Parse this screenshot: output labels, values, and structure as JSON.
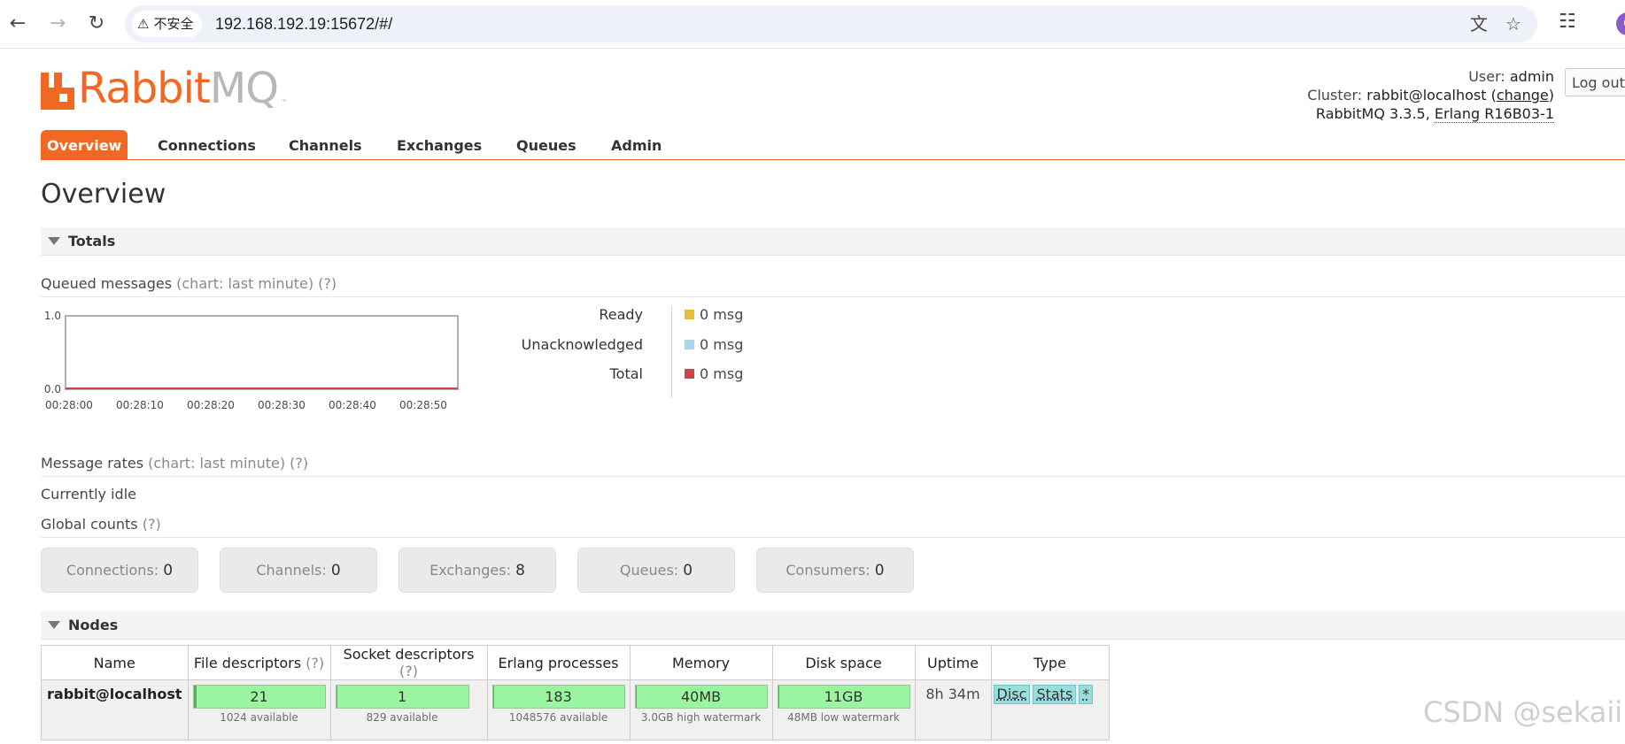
{
  "browser": {
    "security_label": "不安全",
    "url": "192.168.192.19:15672/#/"
  },
  "header": {
    "logo_rabbit": "Rabbit",
    "logo_mq": "MQ",
    "logo_tm": "™",
    "user_label": "User:",
    "user_value": "admin",
    "cluster_label": "Cluster:",
    "cluster_value": "rabbit@localhost",
    "cluster_change_open": "(",
    "cluster_change": "change",
    "cluster_change_close": ")",
    "version": "RabbitMQ 3.3.5,",
    "erlang": "Erlang R16B03-1",
    "logout": "Log out"
  },
  "tabs": [
    "Overview",
    "Connections",
    "Channels",
    "Exchanges",
    "Queues",
    "Admin"
  ],
  "page_title": "Overview",
  "totals": {
    "section_title": "Totals",
    "queued_title": "Queued messages",
    "queued_hint": "(chart: last minute)",
    "queued_help": "(?)",
    "legend": [
      {
        "name": "Ready",
        "value": "0 msg",
        "color": "#e8bc3c"
      },
      {
        "name": "Unacknowledged",
        "value": "0 msg",
        "color": "#aad4f0"
      },
      {
        "name": "Total",
        "value": "0 msg",
        "color": "#cc4444"
      }
    ],
    "rates_title": "Message rates",
    "rates_hint": "(chart: last minute)",
    "rates_help": "(?)",
    "idle": "Currently idle",
    "global_title": "Global counts",
    "global_help": "(?)",
    "counts": [
      {
        "label": "Connections:",
        "value": "0"
      },
      {
        "label": "Channels:",
        "value": "0"
      },
      {
        "label": "Exchanges:",
        "value": "8"
      },
      {
        "label": "Queues:",
        "value": "0"
      },
      {
        "label": "Consumers:",
        "value": "0"
      }
    ]
  },
  "chart_data": {
    "type": "line",
    "x": [
      "00:28:00",
      "00:28:10",
      "00:28:20",
      "00:28:30",
      "00:28:40",
      "00:28:50"
    ],
    "ylim": [
      0.0,
      1.0
    ],
    "yticks": [
      "0.0",
      "1.0"
    ],
    "series": [
      {
        "name": "Ready",
        "values": [
          0,
          0,
          0,
          0,
          0,
          0
        ],
        "color": "#e8bc3c"
      },
      {
        "name": "Unacknowledged",
        "values": [
          0,
          0,
          0,
          0,
          0,
          0
        ],
        "color": "#aad4f0"
      },
      {
        "name": "Total",
        "values": [
          0,
          0,
          0,
          0,
          0,
          0
        ],
        "color": "#cc4444"
      }
    ]
  },
  "nodes": {
    "section_title": "Nodes",
    "columns": [
      {
        "label": "Name",
        "help": ""
      },
      {
        "label": "File descriptors",
        "help": "(?)"
      },
      {
        "label": "Socket descriptors",
        "help": "(?)"
      },
      {
        "label": "Erlang processes",
        "help": ""
      },
      {
        "label": "Memory",
        "help": ""
      },
      {
        "label": "Disk space",
        "help": ""
      },
      {
        "label": "Uptime",
        "help": ""
      },
      {
        "label": "Type",
        "help": ""
      }
    ],
    "row": {
      "name": "rabbit@localhost",
      "file_desc": {
        "value": "21",
        "sub": "1024 available",
        "fraction": 0.0205
      },
      "socket_desc": {
        "value": "1",
        "sub": "829 available",
        "fraction": 0.0012
      },
      "erlang_proc": {
        "value": "183",
        "sub": "1048576 available",
        "fraction": 0.0002
      },
      "memory": {
        "value": "40MB",
        "sub": "3.0GB high watermark",
        "fraction": 0.013
      },
      "disk": {
        "value": "11GB",
        "sub": "48MB low watermark",
        "fraction": 0.0
      },
      "uptime": "8h 34m",
      "type_tags": [
        "Disc",
        "Stats",
        "*"
      ]
    }
  },
  "watermark": "CSDN @sekaii"
}
